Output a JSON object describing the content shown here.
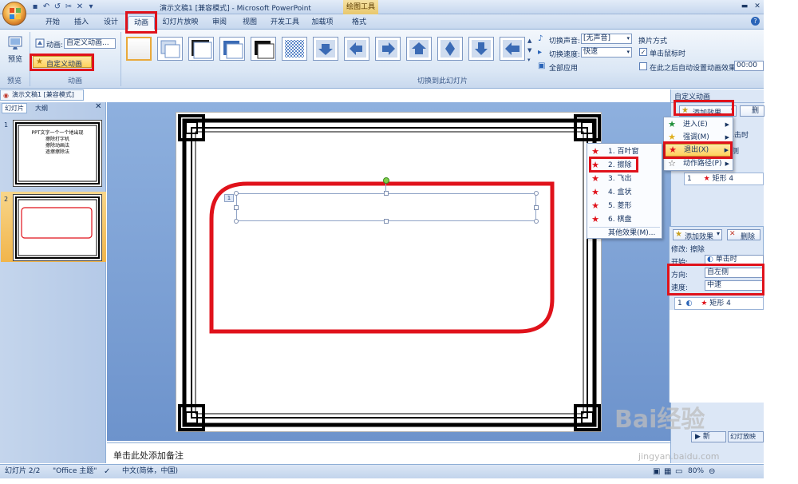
{
  "window": {
    "title": "演示文稿1 [兼容模式] - Microsoft PowerPoint",
    "context_tool": "绘图工具"
  },
  "tabs": [
    "开始",
    "插入",
    "设计",
    "动画",
    "幻灯片放映",
    "审阅",
    "视图",
    "开发工具",
    "加载项",
    "格式"
  ],
  "ribbon": {
    "preview_label": "预览",
    "preview_group": "预览",
    "animation_label": "动画:",
    "animation_value": "自定义动画...",
    "custom_animation_button": "自定义动画",
    "animation_group": "动画",
    "transition_group": "切换到此幻灯片",
    "sound_label": "切换声音:",
    "sound_value": "[无声音]",
    "speed_label": "切换速度:",
    "speed_value": "快速",
    "apply_all": "全部应用",
    "advance_title": "换片方式",
    "on_click": "单击鼠标时",
    "auto_after": "在此之后自动设置动画效果:",
    "auto_time": "00:00"
  },
  "doc_tab": "演示文稿1 [兼容模式]",
  "left_panel": {
    "tab_slides": "幻灯片",
    "tab_outline": "大纲",
    "slide1_num": "1",
    "slide2_num": "2",
    "slide1_text": [
      "PPT文字一个一个地出现",
      "擦除打字机",
      "擦除动画法",
      "逐擦擦除法"
    ]
  },
  "slide": {
    "anim_tag": "1"
  },
  "notes_placeholder": "单击此处添加备注",
  "status": {
    "slide_info": "幻灯片 2/2",
    "theme": "\"Office 主题\"",
    "language": "中文(简体，中国)",
    "zoom": "80%"
  },
  "task_pane": {
    "title": "自定义动画",
    "add_effect": "添加效果",
    "remove": "删除",
    "start_label": "开始:",
    "start_value": "单击时",
    "direction_label": "方向:",
    "direction_value": "自左侧",
    "speed_label": "速度:",
    "speed_value": "中速",
    "modify_label": "修改: 擦除",
    "list_item": "矩形 4",
    "list_num": "1",
    "partial_right": "单击时",
    "partial_right2": "侧",
    "btn_new": "新",
    "btn_play": "幻灯放映"
  },
  "effect_menu": {
    "items": [
      "进入(E)",
      "强调(M)",
      "退出(X)",
      "动作路径(P)"
    ]
  },
  "exit_submenu": {
    "items": [
      "1. 百叶窗",
      "2. 擦除",
      "3. 飞出",
      "4. 盒状",
      "5. 菱形",
      "6. 棋盘"
    ],
    "more": "其他效果(M)..."
  },
  "watermark": "Bai经验",
  "watermark_url": "jingyan.baidu.com"
}
